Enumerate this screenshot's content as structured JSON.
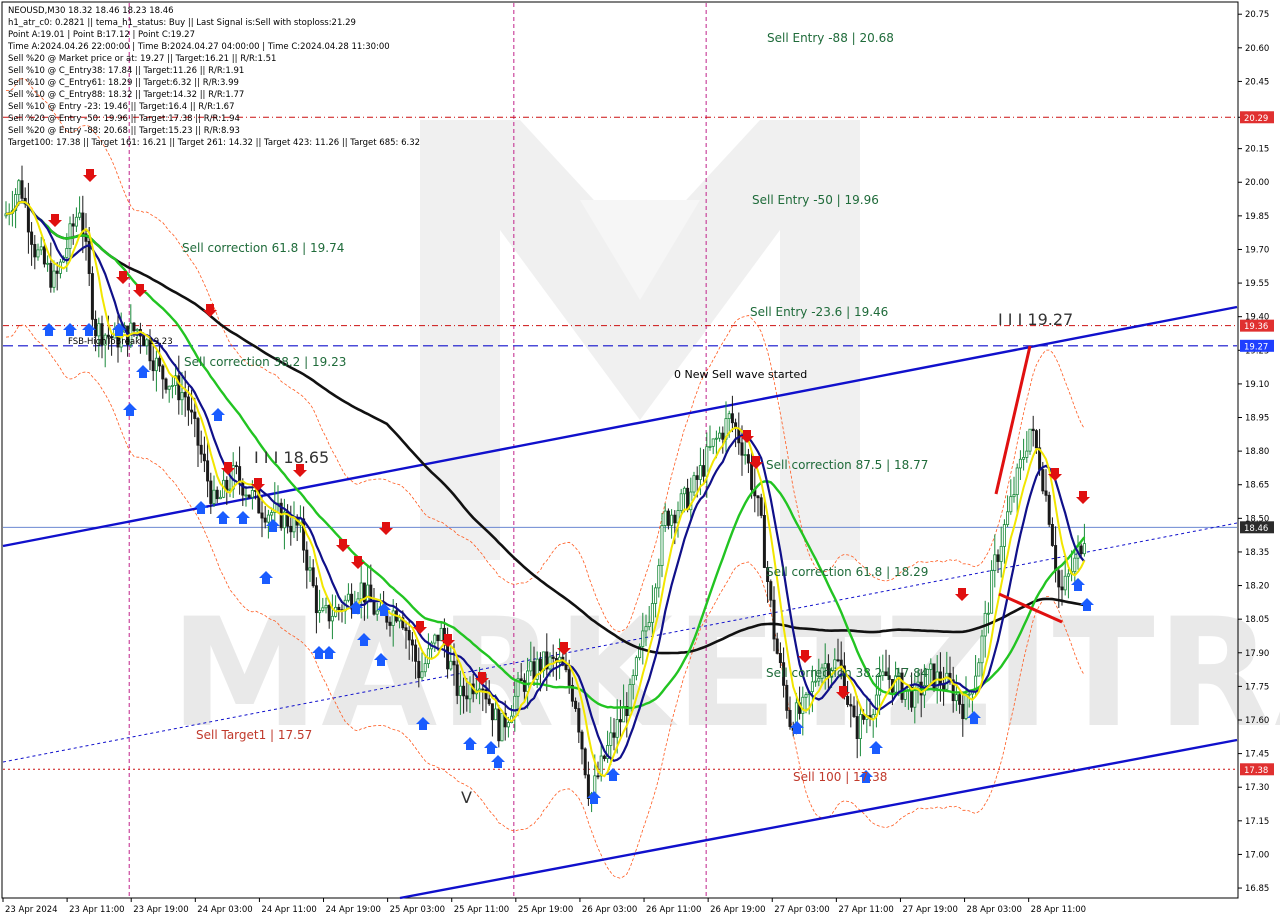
{
  "info_lines": [
    "NEOUSD,M30  18.32 18.46 18.23 18.46",
    "h1_atr_c0: 0.2821 || tema_h1_status: Buy || Last Signal is:Sell with stoploss:21.29",
    "Point A:19.01 | Point B:17.12 | Point C:19.27",
    "Time A:2024.04.26 22:00:00 | Time B:2024.04.27 04:00:00 | Time C:2024.04.28 11:30:00",
    "Sell %20 @ Market price or at: 19.27 || Target:16.21 || R/R:1.51",
    "Sell %10 @ C_Entry38: 17.84 || Target:11.26 || R/R:1.91",
    "Sell %10 @ C_Entry61: 18.29 || Target:6.32 || R/R:3.99",
    "Sell %10 @ C_Entry88: 18.32 || Target:14.32 || R/R:1.77",
    "Sell %10 @ Entry -23: 19.46 || Target:16.4 || R/R:1.67",
    "Sell %20 @ Entry -50: 19.96 || Target:17.38 || R/R:1.94",
    "Sell %20 @ Entry -88: 20.68 || Target:15.23 || R/R:8.93",
    "Target100: 17.38 || Target 161: 16.21 || Target 261: 14.32 || Target 423: 11.26 || Target 685: 6.32"
  ],
  "watermark": "MARKETZITRADE",
  "annotations": {
    "sell_entry_88": "Sell Entry -88 | 20.68",
    "sell_entry_50": "Sell Entry -50 | 19.96",
    "sell_entry_23": "Sell Entry -23.6 | 19.46",
    "point_c": "I I I 19.27",
    "new_wave": "0 New Sell wave started",
    "sell_corr_875": "Sell correction 87.5 | 18.77",
    "sell_corr_618_right": "Sell correction 61.8 | 18.29",
    "sell_corr_382_right": "Sell correction 38.2 | 17.84",
    "sell_100": "Sell 100 | 17.38",
    "sell_corr_618_left": "Sell correction 61.8 | 19.74",
    "sell_corr_382_left": "Sell correction 38.2 | 19.23",
    "fsb_high": "FSB-HighToBreak | 19.23",
    "sell_target1": "Sell Target1 | 17.57",
    "wave_iii_left": "I I I 18.65",
    "wave_v": "V"
  },
  "colors": {
    "background": "#ffffff",
    "channel": "#1010cc",
    "bull_candle": "#1a8a3a",
    "bear_candle": "#1a1a1a",
    "ma_black": "#111111",
    "ma_green": "#22c422",
    "ma_navy": "#10108a",
    "ma_yellow": "#f2e600",
    "envelope": "#ff5a1f",
    "sell_arrow": "#e01010",
    "buy_arrow": "#1a5cff",
    "badge_red": "#e03030",
    "badge_blue": "#1f3fff",
    "badge_dark": "#2b2b2b"
  },
  "chart_data": {
    "type": "candlestick",
    "symbol": "NEOUSD",
    "timeframe": "M30",
    "ylim": [
      16.81,
      20.8
    ],
    "y_ticks": [
      "20.75",
      "20.60",
      "20.45",
      "20.29",
      "20.15",
      "20.00",
      "19.85",
      "19.70",
      "19.55",
      "19.40",
      "19.25",
      "19.10",
      "18.95",
      "18.80",
      "18.65",
      "18.50",
      "18.35",
      "18.20",
      "18.05",
      "17.90",
      "17.75",
      "17.60",
      "17.45",
      "17.30",
      "17.15",
      "17.00",
      "16.85"
    ],
    "x_ticks": [
      "23 Apr 2024",
      "23 Apr 11:00",
      "23 Apr 19:00",
      "24 Apr 03:00",
      "24 Apr 11:00",
      "24 Apr 19:00",
      "25 Apr 03:00",
      "25 Apr 11:00",
      "25 Apr 19:00",
      "26 Apr 03:00",
      "26 Apr 11:00",
      "26 Apr 19:00",
      "27 Apr 03:00",
      "27 Apr 11:00",
      "27 Apr 19:00",
      "28 Apr 03:00",
      "28 Apr 11:00"
    ],
    "price_badges": [
      {
        "label": "20.29",
        "value": 20.29,
        "kind": "red"
      },
      {
        "label": "19.36",
        "value": 19.36,
        "kind": "red"
      },
      {
        "label": "19.27",
        "value": 19.27,
        "kind": "blue"
      },
      {
        "label": "18.46",
        "value": 18.46,
        "kind": "dark"
      },
      {
        "label": "17.38",
        "value": 17.38,
        "kind": "red"
      }
    ],
    "horizontal_levels": [
      {
        "value": 20.29,
        "style": "red-dashdot"
      },
      {
        "value": 19.36,
        "style": "red-dashdot"
      },
      {
        "value": 19.27,
        "style": "blue-dashed"
      },
      {
        "value": 18.46,
        "style": "blue-solid"
      },
      {
        "value": 17.38,
        "style": "red-dotted"
      }
    ],
    "vertical_session_lines": [
      "23 Apr 19:00",
      "25 Apr 19:00",
      "26 Apr 19:00"
    ],
    "last_price": {
      "open": 18.32,
      "high": 18.46,
      "low": 18.23,
      "close": 18.46
    },
    "points": {
      "A": 19.01,
      "B": 17.12,
      "C": 19.27
    }
  }
}
